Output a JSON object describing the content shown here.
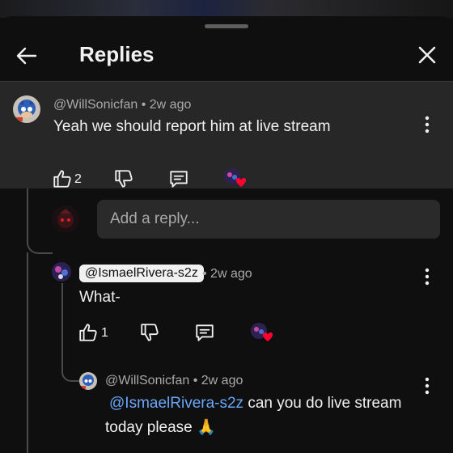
{
  "header": {
    "title": "Replies"
  },
  "parent_comment": {
    "author": "@WillSonicfan",
    "age": "2w ago",
    "separator": " • ",
    "text": "Yeah we should report him at live stream",
    "likes": "2"
  },
  "reply_input": {
    "placeholder": "Add a reply..."
  },
  "replies": [
    {
      "author": "@IsmaelRivera-s2z",
      "age": "2w ago",
      "separator": " • ",
      "text": "What-",
      "likes": "1"
    },
    {
      "author": "@WillSonicfan",
      "age": "2w ago",
      "separator": " • ",
      "mention": "@IsmaelRivera-s2z",
      "text_line1": " can you do live stream",
      "text_line2": "today please 🙏"
    }
  ],
  "colors": {
    "background": "#0f0f0f",
    "highlight": "#272727",
    "mention": "#6aa6f8",
    "heart": "#ff0033"
  },
  "icons": [
    "back-arrow-icon",
    "close-icon",
    "more-vert-icon",
    "thumb-up-icon",
    "thumb-down-icon",
    "reply-icon",
    "creator-heart-icon"
  ]
}
